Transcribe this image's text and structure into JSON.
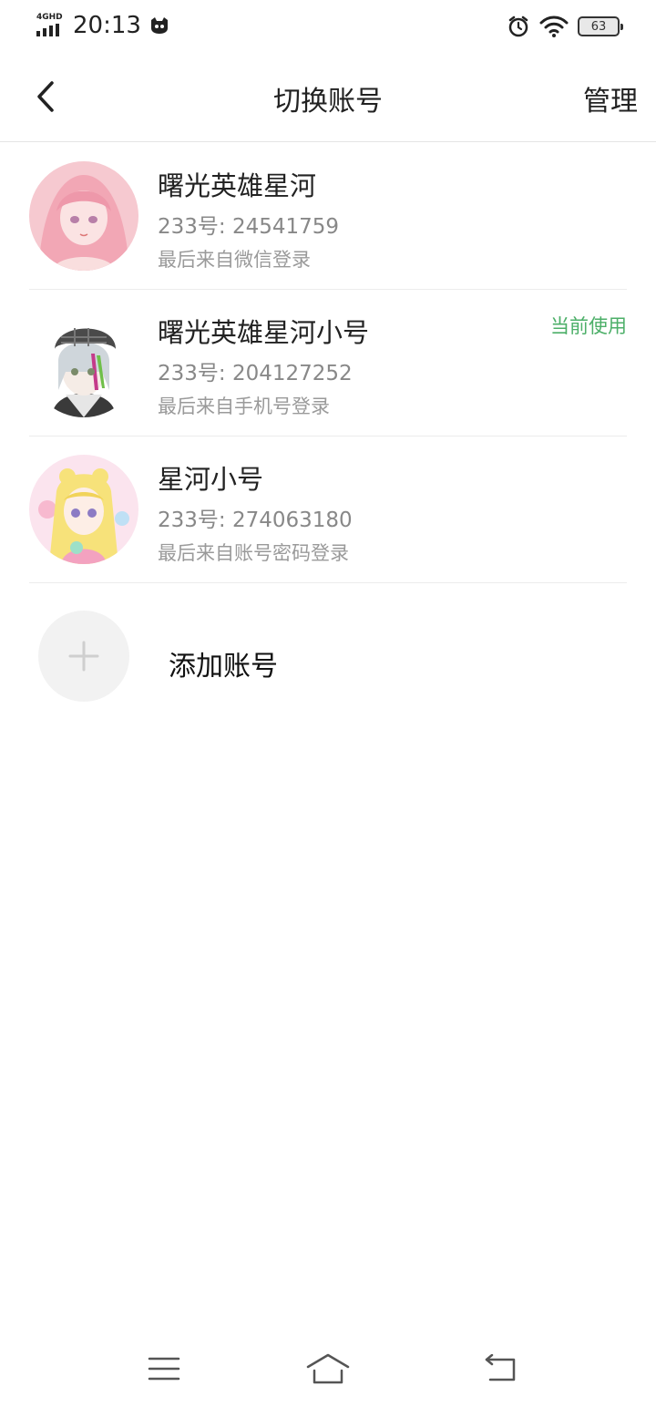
{
  "status_bar": {
    "network_label": "4GHD",
    "time": "20:13",
    "battery_level": "63"
  },
  "header": {
    "title": "切换账号",
    "manage_label": "管理"
  },
  "accounts": [
    {
      "name": "曙光英雄星河",
      "id_line": "233号: 24541759",
      "login_source": "最后来自微信登录",
      "current": false
    },
    {
      "name": "曙光英雄星河小号",
      "id_line": "233号: 204127252",
      "login_source": "最后来自手机号登录",
      "current": true,
      "current_label": "当前使用"
    },
    {
      "name": "星河小号",
      "id_line": "233号: 274063180",
      "login_source": "最后来自账号密码登录",
      "current": false
    }
  ],
  "add_account": {
    "label": "添加账号"
  },
  "colors": {
    "current_badge": "#4caf68",
    "secondary_text": "#888888",
    "divider": "#ececec"
  },
  "icons": {
    "back": "chevron-left-icon",
    "add": "plus-icon",
    "menu": "menu-icon",
    "home": "home-icon",
    "return": "return-icon"
  }
}
